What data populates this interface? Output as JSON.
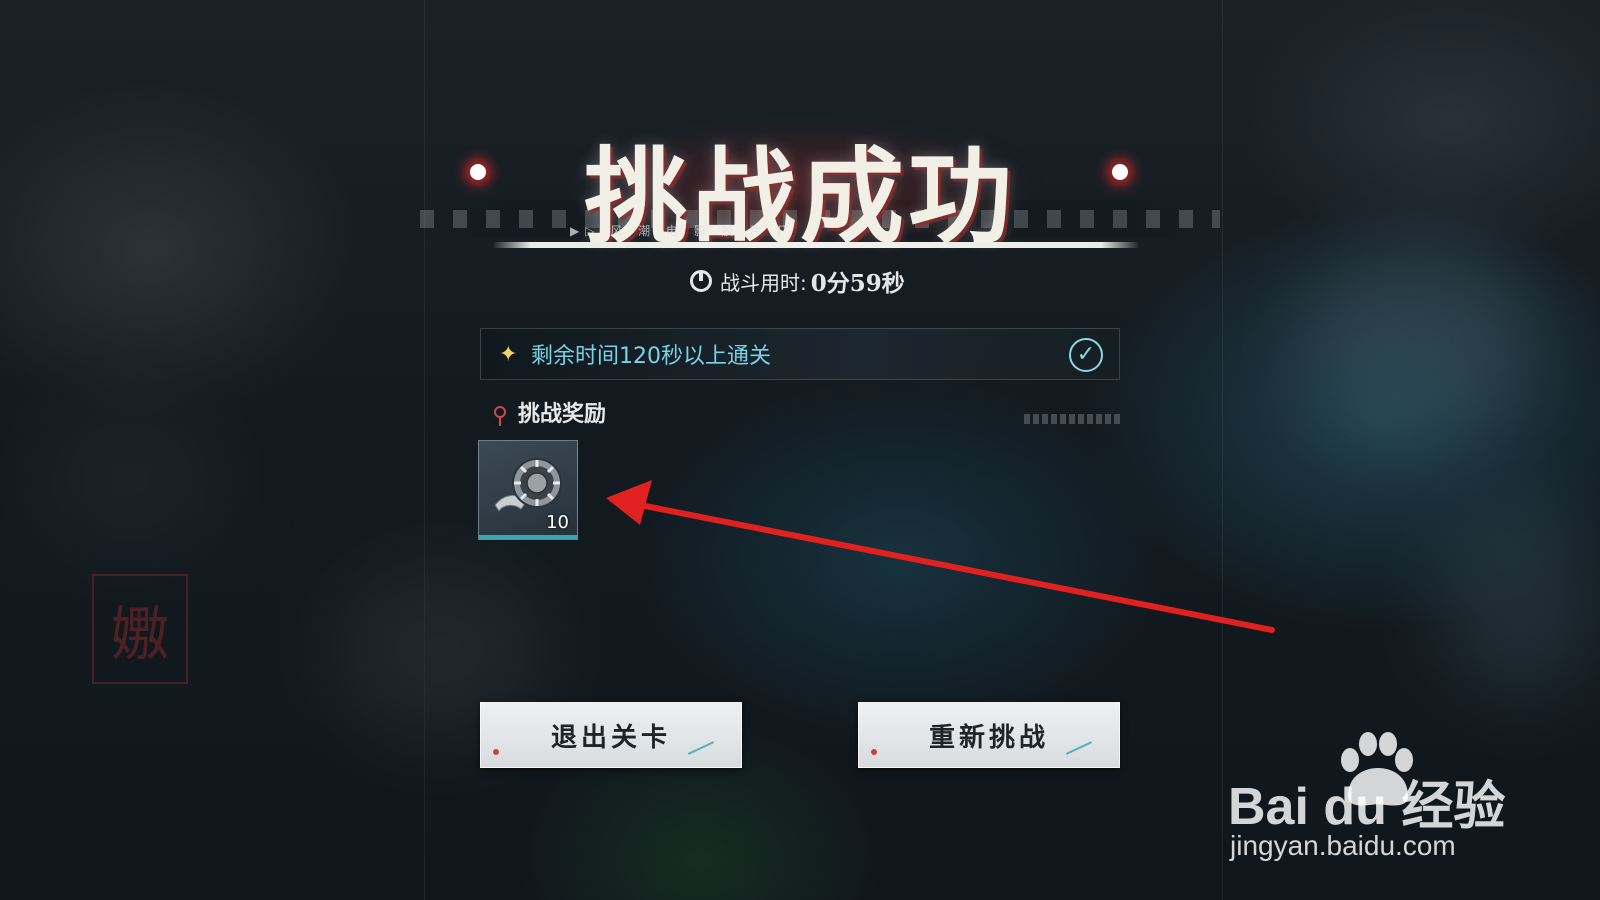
{
  "result": {
    "title": "挑战成功",
    "subtitle": "▶▷ 风 潮 电 影 胶 片 厂",
    "time_label": "战斗用时:",
    "time_value": "0分59秒"
  },
  "objective": {
    "text": "剩余时间120秒以上通关",
    "completed": true
  },
  "rewards": {
    "title": "挑战奖励",
    "items": [
      {
        "icon": "film-reel-icon",
        "count": "10"
      }
    ]
  },
  "buttons": {
    "exit_label": "退出关卡",
    "retry_label": "重新挑战"
  },
  "watermark": {
    "logo_text": "Bai du 经验",
    "url": "jingyan.baidu.com"
  },
  "colors": {
    "objective_text": "#78d3e6",
    "accent_red": "#d04848",
    "arrow_red": "#e0211f",
    "button_bg": "#e8ebed"
  }
}
